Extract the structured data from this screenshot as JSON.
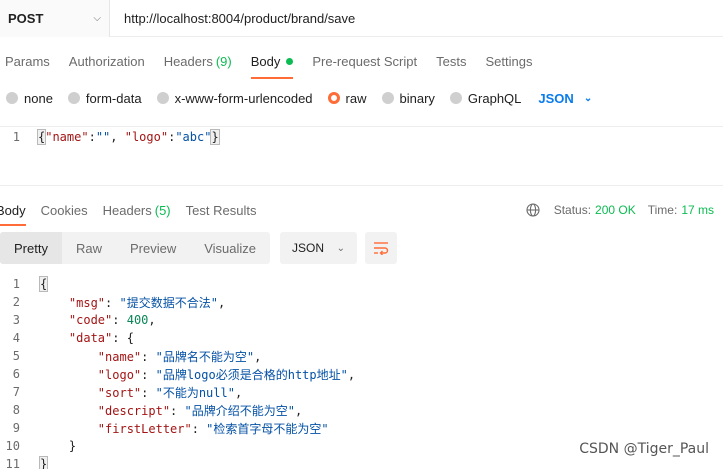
{
  "request": {
    "method": "POST",
    "url": "http://localhost:8004/product/brand/save"
  },
  "request_tabs": [
    {
      "label": "Params"
    },
    {
      "label": "Authorization"
    },
    {
      "label": "Headers",
      "count": "(9)"
    },
    {
      "label": "Body"
    },
    {
      "label": "Pre-request Script"
    },
    {
      "label": "Tests"
    },
    {
      "label": "Settings"
    }
  ],
  "body_types": [
    {
      "label": "none",
      "selected": false
    },
    {
      "label": "form-data",
      "selected": false
    },
    {
      "label": "x-www-form-urlencoded",
      "selected": false
    },
    {
      "label": "raw",
      "selected": true
    },
    {
      "label": "binary",
      "selected": false
    },
    {
      "label": "GraphQL",
      "selected": false
    }
  ],
  "raw_format": "JSON",
  "request_body": {
    "line_number": "1",
    "name_key": "\"name\"",
    "name_value": "\"\"",
    "logo_key": "\"logo\"",
    "logo_value": "\"abc\""
  },
  "response_tabs": [
    {
      "label": "Body"
    },
    {
      "label": "Cookies"
    },
    {
      "label": "Headers",
      "count": "(5)"
    },
    {
      "label": "Test Results"
    }
  ],
  "response_meta": {
    "status_label": "Status:",
    "status_value": "200 OK",
    "time_label": "Time:",
    "time_value": "17 ms"
  },
  "view_modes": [
    "Pretty",
    "Raw",
    "Preview",
    "Visualize"
  ],
  "response_format": "JSON",
  "response_lines": [
    {
      "n": "1",
      "text": "{"
    },
    {
      "n": "2",
      "indent": 1,
      "key": "\"msg\"",
      "value": "\"提交数据不合法\"",
      "type": "str",
      "comma": ","
    },
    {
      "n": "3",
      "indent": 1,
      "key": "\"code\"",
      "value": "400",
      "type": "num",
      "comma": ","
    },
    {
      "n": "4",
      "indent": 1,
      "key": "\"data\"",
      "value": "{",
      "type": "punc",
      "comma": ""
    },
    {
      "n": "5",
      "indent": 2,
      "key": "\"name\"",
      "value": "\"品牌名不能为空\"",
      "type": "str",
      "comma": ","
    },
    {
      "n": "6",
      "indent": 2,
      "key": "\"logo\"",
      "value": "\"品牌logo必须是合格的http地址\"",
      "type": "str",
      "comma": ","
    },
    {
      "n": "7",
      "indent": 2,
      "key": "\"sort\"",
      "value": "\"不能为null\"",
      "type": "str",
      "comma": ","
    },
    {
      "n": "8",
      "indent": 2,
      "key": "\"descript\"",
      "value": "\"品牌介绍不能为空\"",
      "type": "str",
      "comma": ","
    },
    {
      "n": "9",
      "indent": 2,
      "key": "\"firstLetter\"",
      "value": "\"检索首字母不能为空\"",
      "type": "str",
      "comma": ""
    },
    {
      "n": "10",
      "indent": 1,
      "text": "}"
    },
    {
      "n": "11",
      "text": "}"
    }
  ],
  "watermark": "CSDN @Tiger_Paul",
  "colors": {
    "accent": "#ff6c37",
    "success": "#0cbb52",
    "link": "#097bed"
  }
}
